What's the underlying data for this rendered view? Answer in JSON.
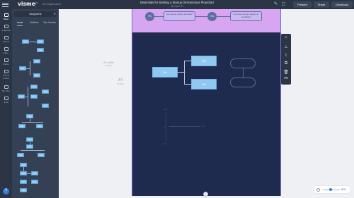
{
  "app": {
    "logo": "visme",
    "undo_icon": "undo-icon",
    "save_status": "All changes saved"
  },
  "document": {
    "title": "Essentials for Starting a Startup Dichotomous Flowchart",
    "subtitle": "By Visme Fl"
  },
  "header_actions": {
    "present": "Present",
    "share": "Share",
    "download": "Download"
  },
  "rail": {
    "items": [
      {
        "label": "Basic",
        "icon": "basic-icon"
      },
      {
        "label": "Graphics",
        "icon": "graphics-icon"
      },
      {
        "label": "Photos",
        "icon": "photos-icon"
      },
      {
        "label": "Data",
        "icon": "data-icon"
      },
      {
        "label": "Media",
        "icon": "media-icon"
      },
      {
        "label": "Theme Colors",
        "icon": "theme-colors-icon"
      },
      {
        "label": "My Files",
        "icon": "my-files-icon"
      },
      {
        "label": "Apps",
        "icon": "apps-icon"
      }
    ],
    "help": "?"
  },
  "panel": {
    "title": "Diagrams",
    "tabs": [
      "Level",
      "Outlines",
      "Two Vendor"
    ],
    "node_label": "Text"
  },
  "stage": {
    "page_format": "US Letter",
    "page_format_sub": "Portrait",
    "page_size_code": "A4",
    "page_size_sub": "Portrait"
  },
  "board": {
    "top": {
      "circle1": "Yes",
      "box1": "Are people buying the idea?",
      "circle2": "Yes",
      "box2": "Improve concept based on feedback"
    },
    "flow": {
      "root": "Text",
      "child1": "Text",
      "child2": "Text",
      "oval1": "",
      "oval2": ""
    },
    "ghost": {
      "top": "Text",
      "middle": "Text",
      "right": "Text",
      "bottom": "Text"
    }
  },
  "zoom": {
    "value": "80%",
    "fraction": 0.45
  }
}
